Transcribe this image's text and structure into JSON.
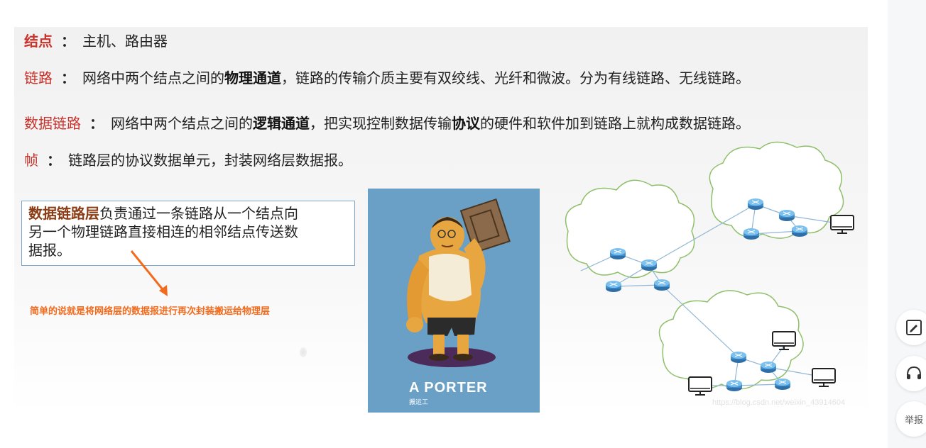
{
  "definitions": [
    {
      "term": "结点",
      "sep": "：",
      "parts": [
        {
          "t": "主机、路由器",
          "b": false
        }
      ]
    },
    {
      "term": "链路",
      "sep": "：",
      "parts": [
        {
          "t": "网络中两个结点之间的",
          "b": false
        },
        {
          "t": "物理通道",
          "b": true
        },
        {
          "t": "，链路的传输介质主要有双绞线、光纤和微波。分为有线链路、无线链路。",
          "b": false
        }
      ]
    },
    {
      "term": "数据链路",
      "sep": "：",
      "parts": [
        {
          "t": "网络中两个结点之间的",
          "b": false
        },
        {
          "t": "逻辑通道",
          "b": true
        },
        {
          "t": "，把实现控制数据传输",
          "b": false
        },
        {
          "t": "协议",
          "b": true
        },
        {
          "t": "的硬件和软件加到链路上就构成数据链路。",
          "b": false
        }
      ]
    },
    {
      "term": "帧",
      "sep": "：",
      "parts": [
        {
          "t": "链路层的协议数据单元，封装网络层数据报。",
          "b": false
        }
      ]
    }
  ],
  "definition_box": {
    "highlight": "数据链路层",
    "line1_rest": "负责通过一条链路从一个结点向",
    "line2": "另一个物理链路直接相连的相邻结点传送数",
    "line3": "据报。"
  },
  "note": "简单的说就是将网络层的数据报进行再次封装搬运给物理层",
  "porter": {
    "title": "A PORTER",
    "subtitle": "搬运工"
  },
  "watermark": "https://blog.csdn.net/weixin_43914604",
  "sidebar": {
    "report_label": "举报"
  },
  "colors": {
    "term": "#c8322a",
    "accent": "#f26b1d",
    "cloud": "#8fbf6a",
    "router": "#3f8fd0",
    "porter_bg": "#6a9fc6"
  }
}
